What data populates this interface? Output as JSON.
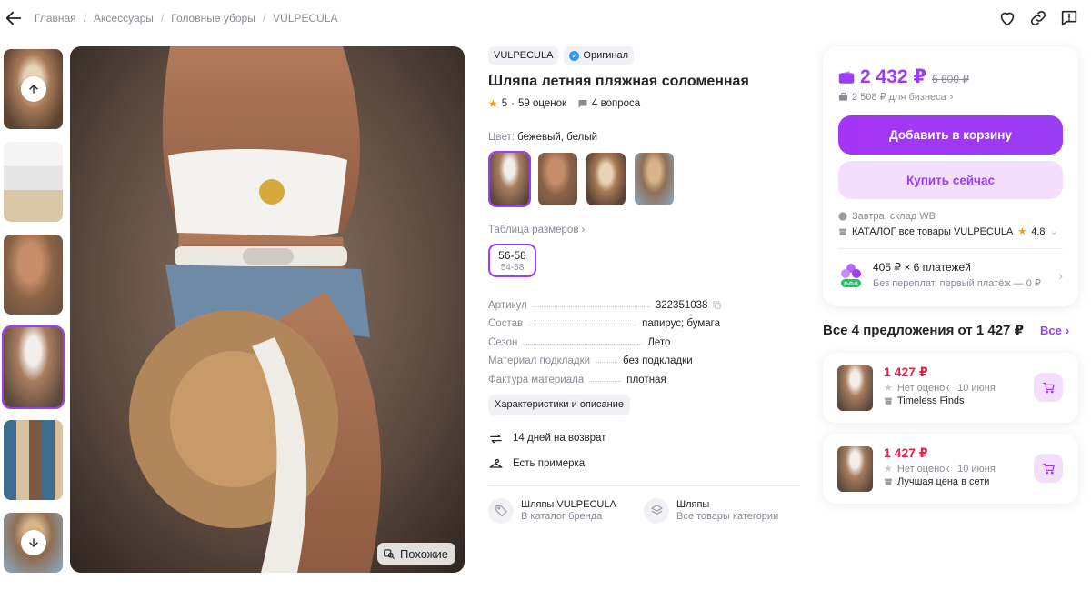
{
  "breadcrumbs": [
    "Главная",
    "Аксессуары",
    "Головные уборы",
    "VULPECULA"
  ],
  "product": {
    "brand": "VULPECULA",
    "original_label": "Оригинал",
    "title": "Шляпа летняя пляжная соломенная",
    "rating": "5",
    "reviews": "59 оценок",
    "questions": "4 вопроса",
    "color_label": "Цвет:",
    "color_value": "бежевый, белый",
    "size_table_link": "Таблица размеров",
    "size_main": "56-58",
    "size_sub": "54-58",
    "specs": [
      {
        "key": "Артикул",
        "value": "322351038"
      },
      {
        "key": "Состав",
        "value": "папирус; бумага"
      },
      {
        "key": "Сезон",
        "value": "Лето"
      },
      {
        "key": "Материал подкладки",
        "value": "без подкладки"
      },
      {
        "key": "Фактура материала",
        "value": "плотная"
      }
    ],
    "chars_button": "Характеристики и описание",
    "features": [
      "14 дней на возврат",
      "Есть примерка"
    ],
    "brand_link": {
      "title": "Шляпы VULPECULA",
      "sub": "В каталог бренда"
    },
    "category_link": {
      "title": "Шляпы",
      "sub": "Все товары категории"
    },
    "similar_label": "Похожие"
  },
  "buy": {
    "price": "2 432 ₽",
    "old_price": "6 600 ₽",
    "business_price": "2 508 ₽ для бизнеса",
    "add_to_cart": "Добавить в корзину",
    "buy_now": "Купить сейчас",
    "delivery": "Завтра, склад WB",
    "seller": "КАТАЛОГ все товары VULPECULA",
    "seller_rating": "4,8",
    "installment_title": "405 ₽ × 6 платежей",
    "installment_sub": "Без переплат, первый платёж — 0 ₽",
    "installment_badge": "0-0-6"
  },
  "offers": {
    "title": "Все 4 предложения от 1 427 ₽",
    "all_label": "Все",
    "items": [
      {
        "price": "1 427 ₽",
        "rating": "Нет оценок",
        "date": "10 июня",
        "seller": "Timeless Finds"
      },
      {
        "price": "1 427 ₽",
        "rating": "Нет оценок",
        "date": "10 июня",
        "seller": "Лучшая цена в сети"
      }
    ]
  },
  "colors": {
    "accent": "#9b3df5",
    "sale": "#e5214a",
    "star": "#ff9b00"
  }
}
